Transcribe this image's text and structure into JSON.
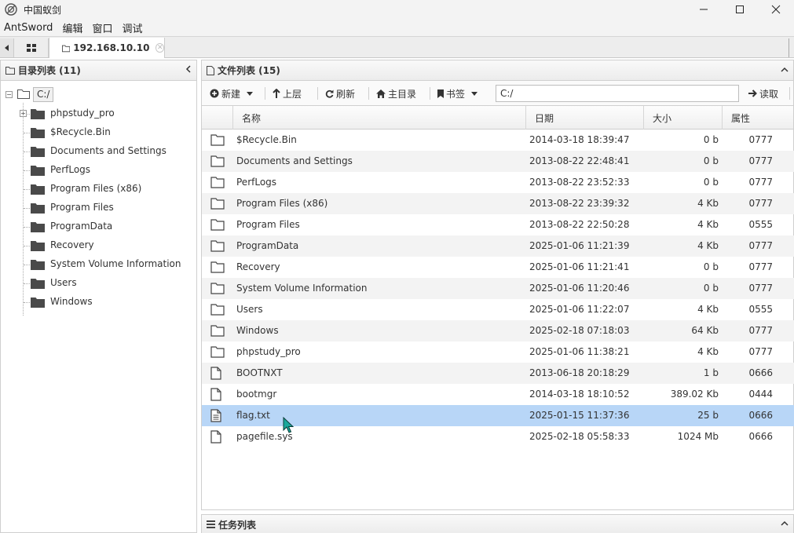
{
  "window": {
    "title": "中国蚁剑"
  },
  "menubar": {
    "items": [
      "AntSword",
      "编辑",
      "窗口",
      "调试"
    ]
  },
  "tabs": {
    "shell_tab_label": "192.168.10.10"
  },
  "dir_panel": {
    "title": "目录列表 (11)",
    "root": "C:/",
    "items": [
      "phpstudy_pro",
      "$Recycle.Bin",
      "Documents and Settings",
      "PerfLogs",
      "Program Files (x86)",
      "Program Files",
      "ProgramData",
      "Recovery",
      "System Volume Information",
      "Users",
      "Windows"
    ]
  },
  "file_panel": {
    "title": "文件列表 (15)",
    "toolbar": {
      "new_label": "新建",
      "up_label": "上层",
      "refresh_label": "刷新",
      "home_label": "主目录",
      "bookmark_label": "书签",
      "path_value": "C:/",
      "read_label": "读取"
    },
    "columns": {
      "name": "名称",
      "date": "日期",
      "size": "大小",
      "attr": "属性"
    },
    "rows": [
      {
        "type": "folder",
        "name": "$Recycle.Bin",
        "date": "2014-03-18 18:39:47",
        "size": "0 b",
        "attr": "0777"
      },
      {
        "type": "folder",
        "name": "Documents and Settings",
        "date": "2013-08-22 22:48:41",
        "size": "0 b",
        "attr": "0777"
      },
      {
        "type": "folder",
        "name": "PerfLogs",
        "date": "2013-08-22 23:52:33",
        "size": "0 b",
        "attr": "0777"
      },
      {
        "type": "folder",
        "name": "Program Files (x86)",
        "date": "2013-08-22 23:39:32",
        "size": "4 Kb",
        "attr": "0777"
      },
      {
        "type": "folder",
        "name": "Program Files",
        "date": "2013-08-22 22:50:28",
        "size": "4 Kb",
        "attr": "0555"
      },
      {
        "type": "folder",
        "name": "ProgramData",
        "date": "2025-01-06 11:21:39",
        "size": "4 Kb",
        "attr": "0777"
      },
      {
        "type": "folder",
        "name": "Recovery",
        "date": "2025-01-06 11:21:41",
        "size": "0 b",
        "attr": "0777"
      },
      {
        "type": "folder",
        "name": "System Volume Information",
        "date": "2025-01-06 11:20:46",
        "size": "0 b",
        "attr": "0777"
      },
      {
        "type": "folder",
        "name": "Users",
        "date": "2025-01-06 11:22:07",
        "size": "4 Kb",
        "attr": "0555"
      },
      {
        "type": "folder",
        "name": "Windows",
        "date": "2025-02-18 07:18:03",
        "size": "64 Kb",
        "attr": "0777"
      },
      {
        "type": "folder",
        "name": "phpstudy_pro",
        "date": "2025-01-06 11:38:21",
        "size": "4 Kb",
        "attr": "0777"
      },
      {
        "type": "file",
        "name": "BOOTNXT",
        "date": "2013-06-18 20:18:29",
        "size": "1 b",
        "attr": "0666"
      },
      {
        "type": "file",
        "name": "bootmgr",
        "date": "2014-03-18 18:10:52",
        "size": "389.02 Kb",
        "attr": "0444"
      },
      {
        "type": "text",
        "name": "flag.txt",
        "date": "2025-01-15 11:37:36",
        "size": "25 b",
        "attr": "0666",
        "selected": true
      },
      {
        "type": "file",
        "name": "pagefile.sys",
        "date": "2025-02-18 05:58:33",
        "size": "1024 Mb",
        "attr": "0666"
      }
    ]
  },
  "task_panel": {
    "title": "任务列表"
  },
  "colors": {
    "selected_row": "#b8d6f7",
    "alt_row": "#f3f3f3",
    "cursor_fill": "#1aa79b"
  }
}
